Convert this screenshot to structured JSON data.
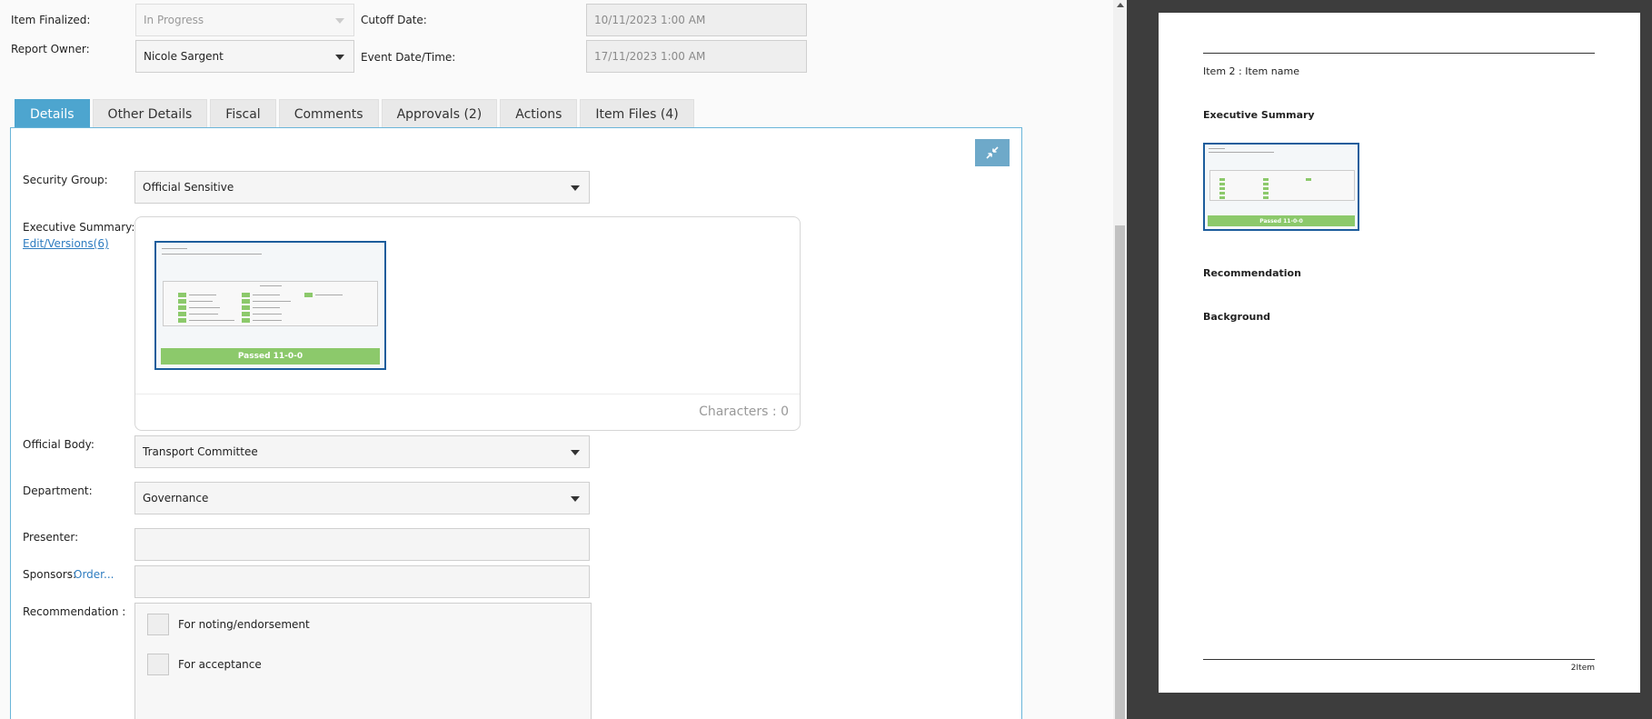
{
  "header": {
    "item_finalized_label": "Item Finalized:",
    "item_finalized_value": "In Progress",
    "report_owner_label": "Report Owner:",
    "report_owner_value": "Nicole Sargent",
    "cutoff_date_label": "Cutoff Date:",
    "cutoff_date_value": "10/11/2023 1:00 AM",
    "event_datetime_label": "Event Date/Time:",
    "event_datetime_value": "17/11/2023 1:00 AM"
  },
  "tabs": [
    {
      "label": "Details",
      "active": true
    },
    {
      "label": "Other Details"
    },
    {
      "label": "Fiscal"
    },
    {
      "label": "Comments"
    },
    {
      "label": "Approvals (2)"
    },
    {
      "label": "Actions"
    },
    {
      "label": "Item Files (4)"
    }
  ],
  "form": {
    "security_group_label": "Security Group:",
    "security_group_value": "Official Sensitive",
    "exec_summary_label": "Executive Summary:",
    "exec_summary_link": "Edit/Versions(6)",
    "characters_label": "Characters : 0",
    "official_body_label": "Official Body:",
    "official_body_value": "Transport Committee",
    "department_label": "Department:",
    "department_value": "Governance",
    "presenter_label": "Presenter:",
    "sponsors_label": "Sponsors:",
    "sponsors_link": "Order...",
    "recommendation_label": "Recommendation :",
    "recommendation_options": [
      "For noting/endorsement",
      "For acceptance"
    ]
  },
  "thumbnail": {
    "passed_label": "Passed 11-0-0"
  },
  "preview": {
    "item_title": "Item 2 : Item name",
    "exec_summary_heading": "Executive Summary",
    "recommendation_heading": "Recommendation",
    "background_heading": "Background",
    "passed_label": "Passed 11-0-0",
    "footer_text": "2Item"
  },
  "colors": {
    "tab_active": "#4da5cf",
    "passed_green": "#8cc96b",
    "thumb_border": "#1c5d9c",
    "link": "#2e7cc0"
  }
}
